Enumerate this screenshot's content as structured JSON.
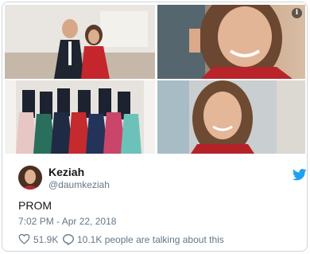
{
  "media": {
    "photos": [
      {
        "name": "couple-photo"
      },
      {
        "name": "selfie-closeup"
      },
      {
        "name": "group-photo"
      },
      {
        "name": "portrait-photo"
      }
    ],
    "info_icon": "i"
  },
  "author": {
    "name": "Keziah",
    "handle": "@daumkeziah",
    "avatar_icon": "avatar"
  },
  "tweet": {
    "text": "PROM",
    "timestamp": "7:02 PM - Apr 22, 2018"
  },
  "actions": {
    "likes": "51.9K",
    "talking": "10.1K people are talking about this"
  },
  "colors": {
    "twitter_blue": "#1da1f2",
    "secondary_text": "#657786",
    "border": "#cfd6dc"
  }
}
